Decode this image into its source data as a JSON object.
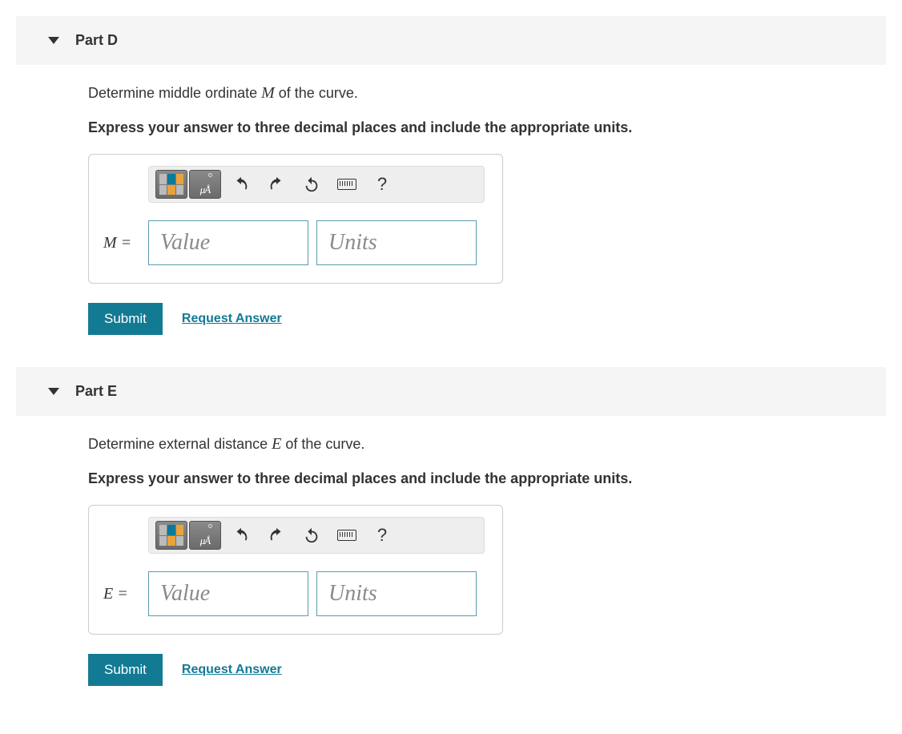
{
  "parts": [
    {
      "title": "Part D",
      "prompt_prefix": "Determine middle ordinate ",
      "prompt_var": "M",
      "prompt_suffix": " of the curve.",
      "instruction": "Express your answer to three decimal places and include the appropriate units.",
      "var_label": "M =",
      "value_placeholder": "Value",
      "units_placeholder": "Units",
      "submit_label": "Submit",
      "request_label": "Request Answer",
      "toolbar": {
        "units_symbol": "μÅ",
        "help_symbol": "?"
      }
    },
    {
      "title": "Part E",
      "prompt_prefix": "Determine external distance ",
      "prompt_var": "E",
      "prompt_suffix": " of the curve.",
      "instruction": "Express your answer to three decimal places and include the appropriate units.",
      "var_label": "E =",
      "value_placeholder": "Value",
      "units_placeholder": "Units",
      "submit_label": "Submit",
      "request_label": "Request Answer",
      "toolbar": {
        "units_symbol": "μÅ",
        "help_symbol": "?"
      }
    }
  ]
}
